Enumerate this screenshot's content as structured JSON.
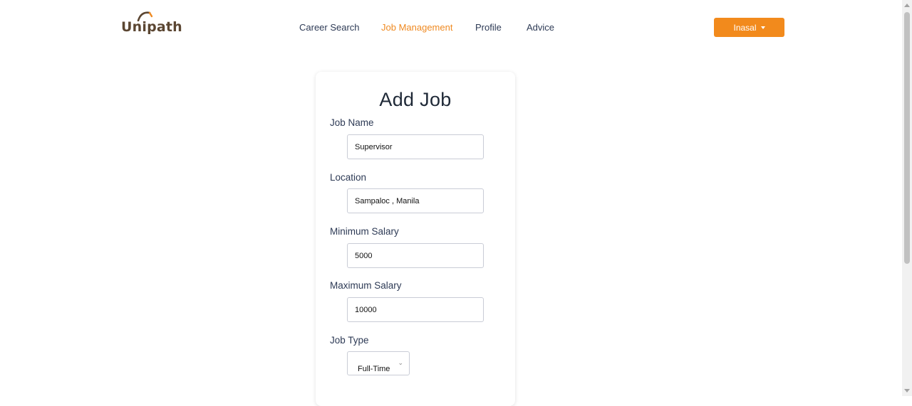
{
  "brand": {
    "name": "Unipath",
    "color": "#5b4632",
    "accent": "#ef8a22"
  },
  "nav": {
    "items": [
      {
        "label": "Career Search",
        "active": false
      },
      {
        "label": "Job Management",
        "active": true
      },
      {
        "label": "Profile",
        "active": false
      },
      {
        "label": "Advice",
        "active": false
      }
    ]
  },
  "user_menu": {
    "label": "Inasal",
    "icon": "caret-down-icon",
    "color": "#f28a1c"
  },
  "form": {
    "title": "Add Job",
    "fields": {
      "job_name": {
        "label": "Job Name",
        "value": "Supervisor"
      },
      "location": {
        "label": "Location",
        "value": "Sampaloc , Manila"
      },
      "min_salary": {
        "label": "Minimum Salary",
        "value": "5000"
      },
      "max_salary": {
        "label": "Maximum Salary",
        "value": "10000"
      },
      "job_type": {
        "label": "Job Type",
        "selected": "Full-Time",
        "icon": "chevron-down-icon"
      }
    }
  }
}
